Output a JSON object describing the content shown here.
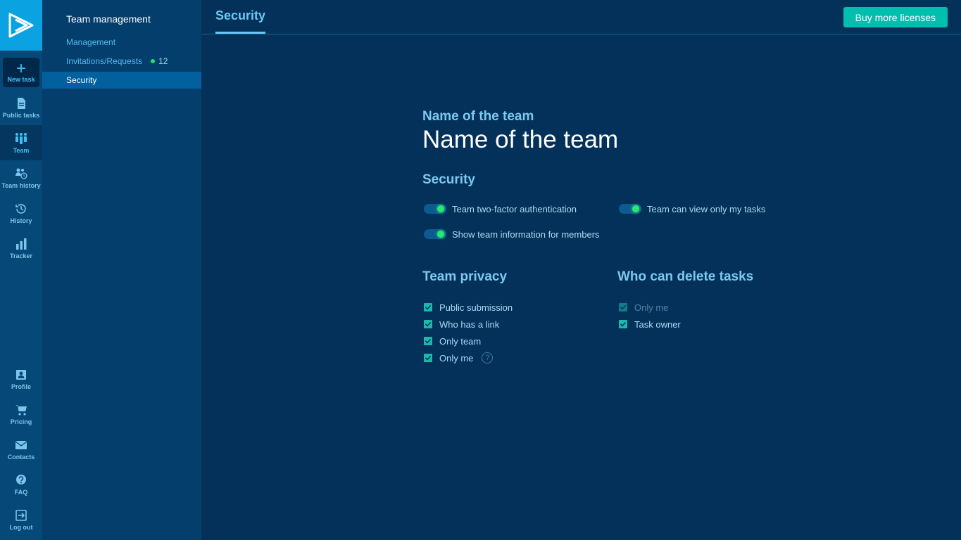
{
  "rail": {
    "new_task": "New task",
    "top_items": [
      {
        "label": "Public tasks",
        "icon": "document-icon"
      },
      {
        "label": "Team",
        "icon": "team-icon",
        "active": true
      },
      {
        "label": "Team history",
        "icon": "team-history-icon"
      },
      {
        "label": "History",
        "icon": "history-icon"
      },
      {
        "label": "Tracker",
        "icon": "bar-chart-icon"
      }
    ],
    "bottom_items": [
      {
        "label": "Profile",
        "icon": "profile-icon"
      },
      {
        "label": "Pricing",
        "icon": "cart-icon"
      },
      {
        "label": "Contacts",
        "icon": "mail-icon"
      },
      {
        "label": "FAQ",
        "icon": "help-icon"
      },
      {
        "label": "Log out",
        "icon": "logout-icon"
      }
    ]
  },
  "subnav": {
    "title": "Team management",
    "items": [
      {
        "label": "Management"
      },
      {
        "label": "Invitations/Requests",
        "badge": "12"
      },
      {
        "label": "Security",
        "active": true
      }
    ]
  },
  "header": {
    "tab": "Security",
    "buy_button": "Buy more licenses"
  },
  "main": {
    "team_label": "Name of the team",
    "team_name": "Name of the team",
    "security_title": "Security",
    "toggles": [
      {
        "label": "Team two-factor authentication",
        "on": true
      },
      {
        "label": "Team can view only my tasks",
        "on": true
      },
      {
        "label": "Show team information for members",
        "on": true
      }
    ],
    "privacy_title": "Team privacy",
    "privacy_options": [
      {
        "label": "Public submission",
        "checked": true
      },
      {
        "label": "Who has a link",
        "checked": true
      },
      {
        "label": "Only team",
        "checked": true
      },
      {
        "label": "Only me",
        "checked": true,
        "help": "?"
      }
    ],
    "delete_title": "Who can delete tasks",
    "delete_options": [
      {
        "label": "Only me",
        "checked": true,
        "disabled": true
      },
      {
        "label": "Task owner",
        "checked": true
      }
    ]
  },
  "colors": {
    "accent": "#6cc8f6",
    "button": "#00bfae",
    "toggle_on": "#28e86e",
    "background": "#033159"
  }
}
